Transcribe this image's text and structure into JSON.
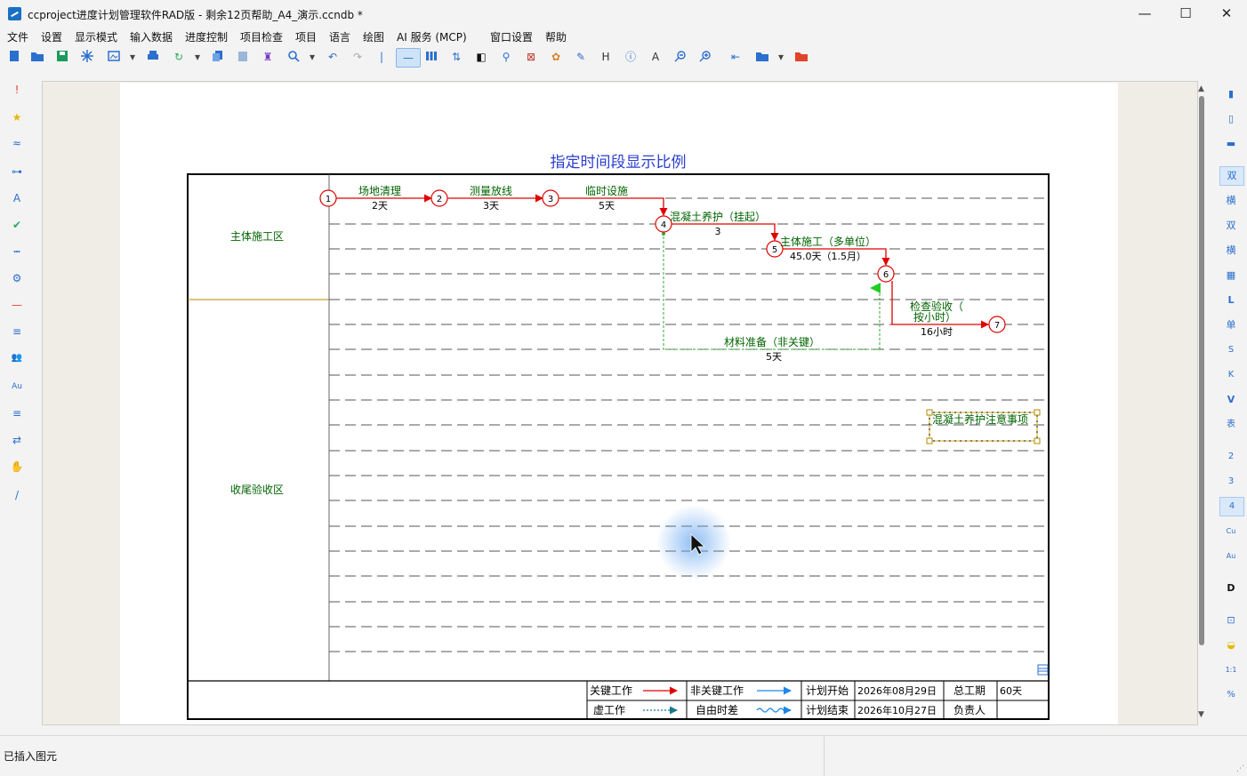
{
  "window": {
    "title": "ccproject进度计划管理软件RAD版 - 剩余12页帮助_A4_演示.ccndb *",
    "minimize": "—",
    "maximize": "☐",
    "close": "✕"
  },
  "menu": [
    "文件",
    "设置",
    "显示模式",
    "输入数据",
    "进度控制",
    "项目检查",
    "项目",
    "语言",
    "绘图",
    "AI 服务 (MCP)",
    "窗口设置",
    "帮助"
  ],
  "toolbar_icons": [
    "new-file-icon",
    "open-folder-icon",
    "save-icon",
    "snowflake-icon",
    "image-export-icon",
    "print-icon",
    "refresh-icon",
    "copy-icon",
    "paste-icon",
    "format-brush-icon",
    "search-icon",
    "undo-icon",
    "redo-icon",
    "line-mode-icon",
    "bar-mode-icon",
    "sort-icon",
    "contrast-icon",
    "link-icon",
    "delete-icon",
    "palette-icon",
    "edit-icon",
    "heading-icon",
    "info-icon",
    "text-icon",
    "zoom-out-icon",
    "zoom-in-icon",
    "back-icon",
    "folder-icon",
    "red-folder-icon"
  ],
  "toolbar_glyphs": {
    "heading": "H",
    "info": "ⓘ",
    "text": "A"
  },
  "left_tools": [
    "!",
    "★",
    "≈",
    "⊶",
    "A",
    "✔",
    "┅",
    "⚙",
    "—",
    "≡",
    "👥",
    "Au",
    "≡",
    "⇄",
    "✋",
    "/"
  ],
  "right_tools": [
    "▮",
    "▯",
    "▬",
    "双",
    "横",
    "双",
    "横",
    "▦",
    "L",
    "单",
    "S",
    "K",
    "V",
    "表",
    "2",
    "3",
    "4",
    "Cu",
    "Au",
    "D",
    "⊡",
    "◒",
    "1:1",
    "%"
  ],
  "diagram": {
    "title": "指定时间段显示比例",
    "zones": [
      "主体施工区",
      "收尾验收区"
    ],
    "nodes": [
      "1",
      "2",
      "3",
      "4",
      "5",
      "6",
      "7"
    ],
    "tasks": [
      {
        "name": "场地清理",
        "duration": "2天"
      },
      {
        "name": "测量放线",
        "duration": "3天"
      },
      {
        "name": "临时设施",
        "duration": "5天"
      },
      {
        "name": "混凝土养护（挂起）",
        "duration": "3"
      },
      {
        "name": "主体施工（多单位）",
        "duration": "45.0天（1.5月）"
      },
      {
        "name": "检查验收（",
        "name2": "按小时）",
        "duration": "16小时"
      },
      {
        "name": "材料准备（非关键）",
        "duration": "5天"
      }
    ],
    "note": "混凝土养护注意事项",
    "legend": {
      "critical": "关键工作",
      "noncritical": "非关键工作",
      "dummy": "虚工作",
      "float": "自由时差",
      "plan_start_label": "计划开始",
      "plan_start": "2026年08月29日",
      "plan_end_label": "计划结束",
      "plan_end": "2026年10月27日",
      "total_label": "总工期",
      "total": "60天",
      "owner_label": "负责人",
      "owner": ""
    },
    "colors": {
      "critical": "#e00000",
      "text_green": "#006400",
      "title": "#2a3fd0",
      "dummy": "#33aa33"
    }
  },
  "status": {
    "message": "已插入图元"
  }
}
